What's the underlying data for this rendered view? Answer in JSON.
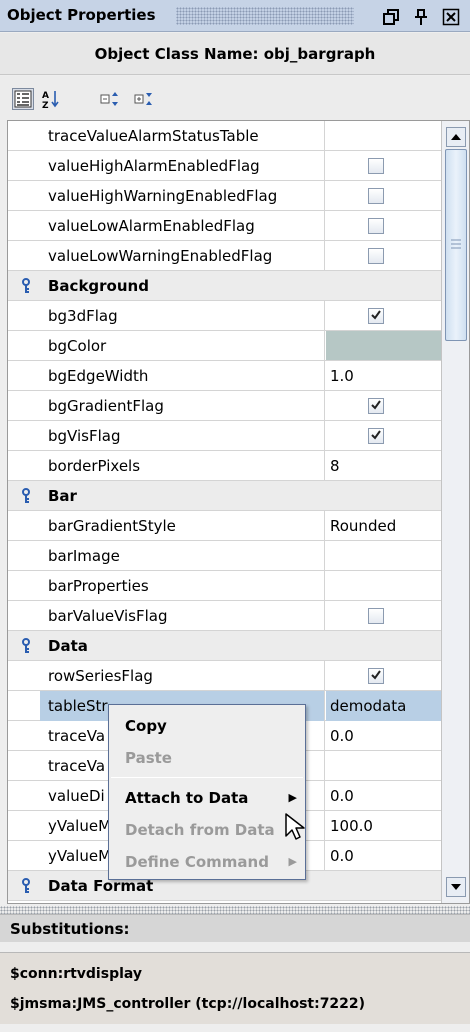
{
  "titlebar": {
    "title": "Object Properties",
    "buttons": [
      "restore-icon",
      "pin-icon",
      "close-icon"
    ]
  },
  "class_header": "Object Class Name: obj_bargraph",
  "toolbar": {
    "tools": [
      "categorized-view-icon",
      "sort-alphabetical-icon",
      "expand-all-icon",
      "collapse-all-icon"
    ]
  },
  "rows": [
    {
      "type": "prop",
      "name": "traceValueAlarmStatusTable",
      "value": ""
    },
    {
      "type": "prop",
      "name": "valueHighAlarmEnabledFlag",
      "checkbox": true,
      "checked": false
    },
    {
      "type": "prop",
      "name": "valueHighWarningEnabledFlag",
      "checkbox": true,
      "checked": false
    },
    {
      "type": "prop",
      "name": "valueLowAlarmEnabledFlag",
      "checkbox": true,
      "checked": false
    },
    {
      "type": "prop",
      "name": "valueLowWarningEnabledFlag",
      "checkbox": true,
      "checked": false
    },
    {
      "type": "category",
      "name": "Background"
    },
    {
      "type": "prop",
      "name": "bg3dFlag",
      "checkbox": true,
      "checked": true
    },
    {
      "type": "prop",
      "name": "bgColor",
      "color": "#b6c7c5"
    },
    {
      "type": "prop",
      "name": "bgEdgeWidth",
      "value": "1.0"
    },
    {
      "type": "prop",
      "name": "bgGradientFlag",
      "checkbox": true,
      "checked": true
    },
    {
      "type": "prop",
      "name": "bgVisFlag",
      "checkbox": true,
      "checked": true
    },
    {
      "type": "prop",
      "name": "borderPixels",
      "value": "8"
    },
    {
      "type": "category",
      "name": "Bar"
    },
    {
      "type": "prop",
      "name": "barGradientStyle",
      "value": "Rounded"
    },
    {
      "type": "prop",
      "name": "barImage",
      "value": ""
    },
    {
      "type": "prop",
      "name": "barProperties",
      "value": ""
    },
    {
      "type": "prop",
      "name": "barValueVisFlag",
      "checkbox": true,
      "checked": false
    },
    {
      "type": "category",
      "name": "Data"
    },
    {
      "type": "prop",
      "name": "rowSeriesFlag",
      "checkbox": true,
      "checked": true
    },
    {
      "type": "prop",
      "name": "tableStr",
      "value": "demodata",
      "selected": true
    },
    {
      "type": "prop",
      "name": "traceVa",
      "value": "0.0"
    },
    {
      "type": "prop",
      "name": "traceVa",
      "value": ""
    },
    {
      "type": "prop",
      "name": "valueDi",
      "value": "0.0"
    },
    {
      "type": "prop",
      "name": "yValueM",
      "value": "100.0"
    },
    {
      "type": "prop",
      "name": "yValueMin",
      "value": "0.0"
    },
    {
      "type": "category",
      "name": "Data Format"
    }
  ],
  "context_menu": {
    "items": [
      {
        "label": "Copy",
        "enabled": true,
        "submenu": false
      },
      {
        "label": "Paste",
        "enabled": false,
        "submenu": false
      },
      {
        "label": "Attach to Data",
        "enabled": true,
        "submenu": true
      },
      {
        "label": "Detach from Data",
        "enabled": false,
        "submenu": false
      },
      {
        "label": "Define Command",
        "enabled": false,
        "submenu": true
      }
    ]
  },
  "substitutions": {
    "label": "Substitutions:",
    "lines": [
      "$conn:rtvdisplay",
      "$jmsma:JMS_controller (tcp://localhost:7222)"
    ]
  },
  "colors": {
    "titlebar_bg": "#c6d3e6",
    "selection": "#b8cfe5",
    "bgColor_swatch": "#b6c7c5"
  }
}
